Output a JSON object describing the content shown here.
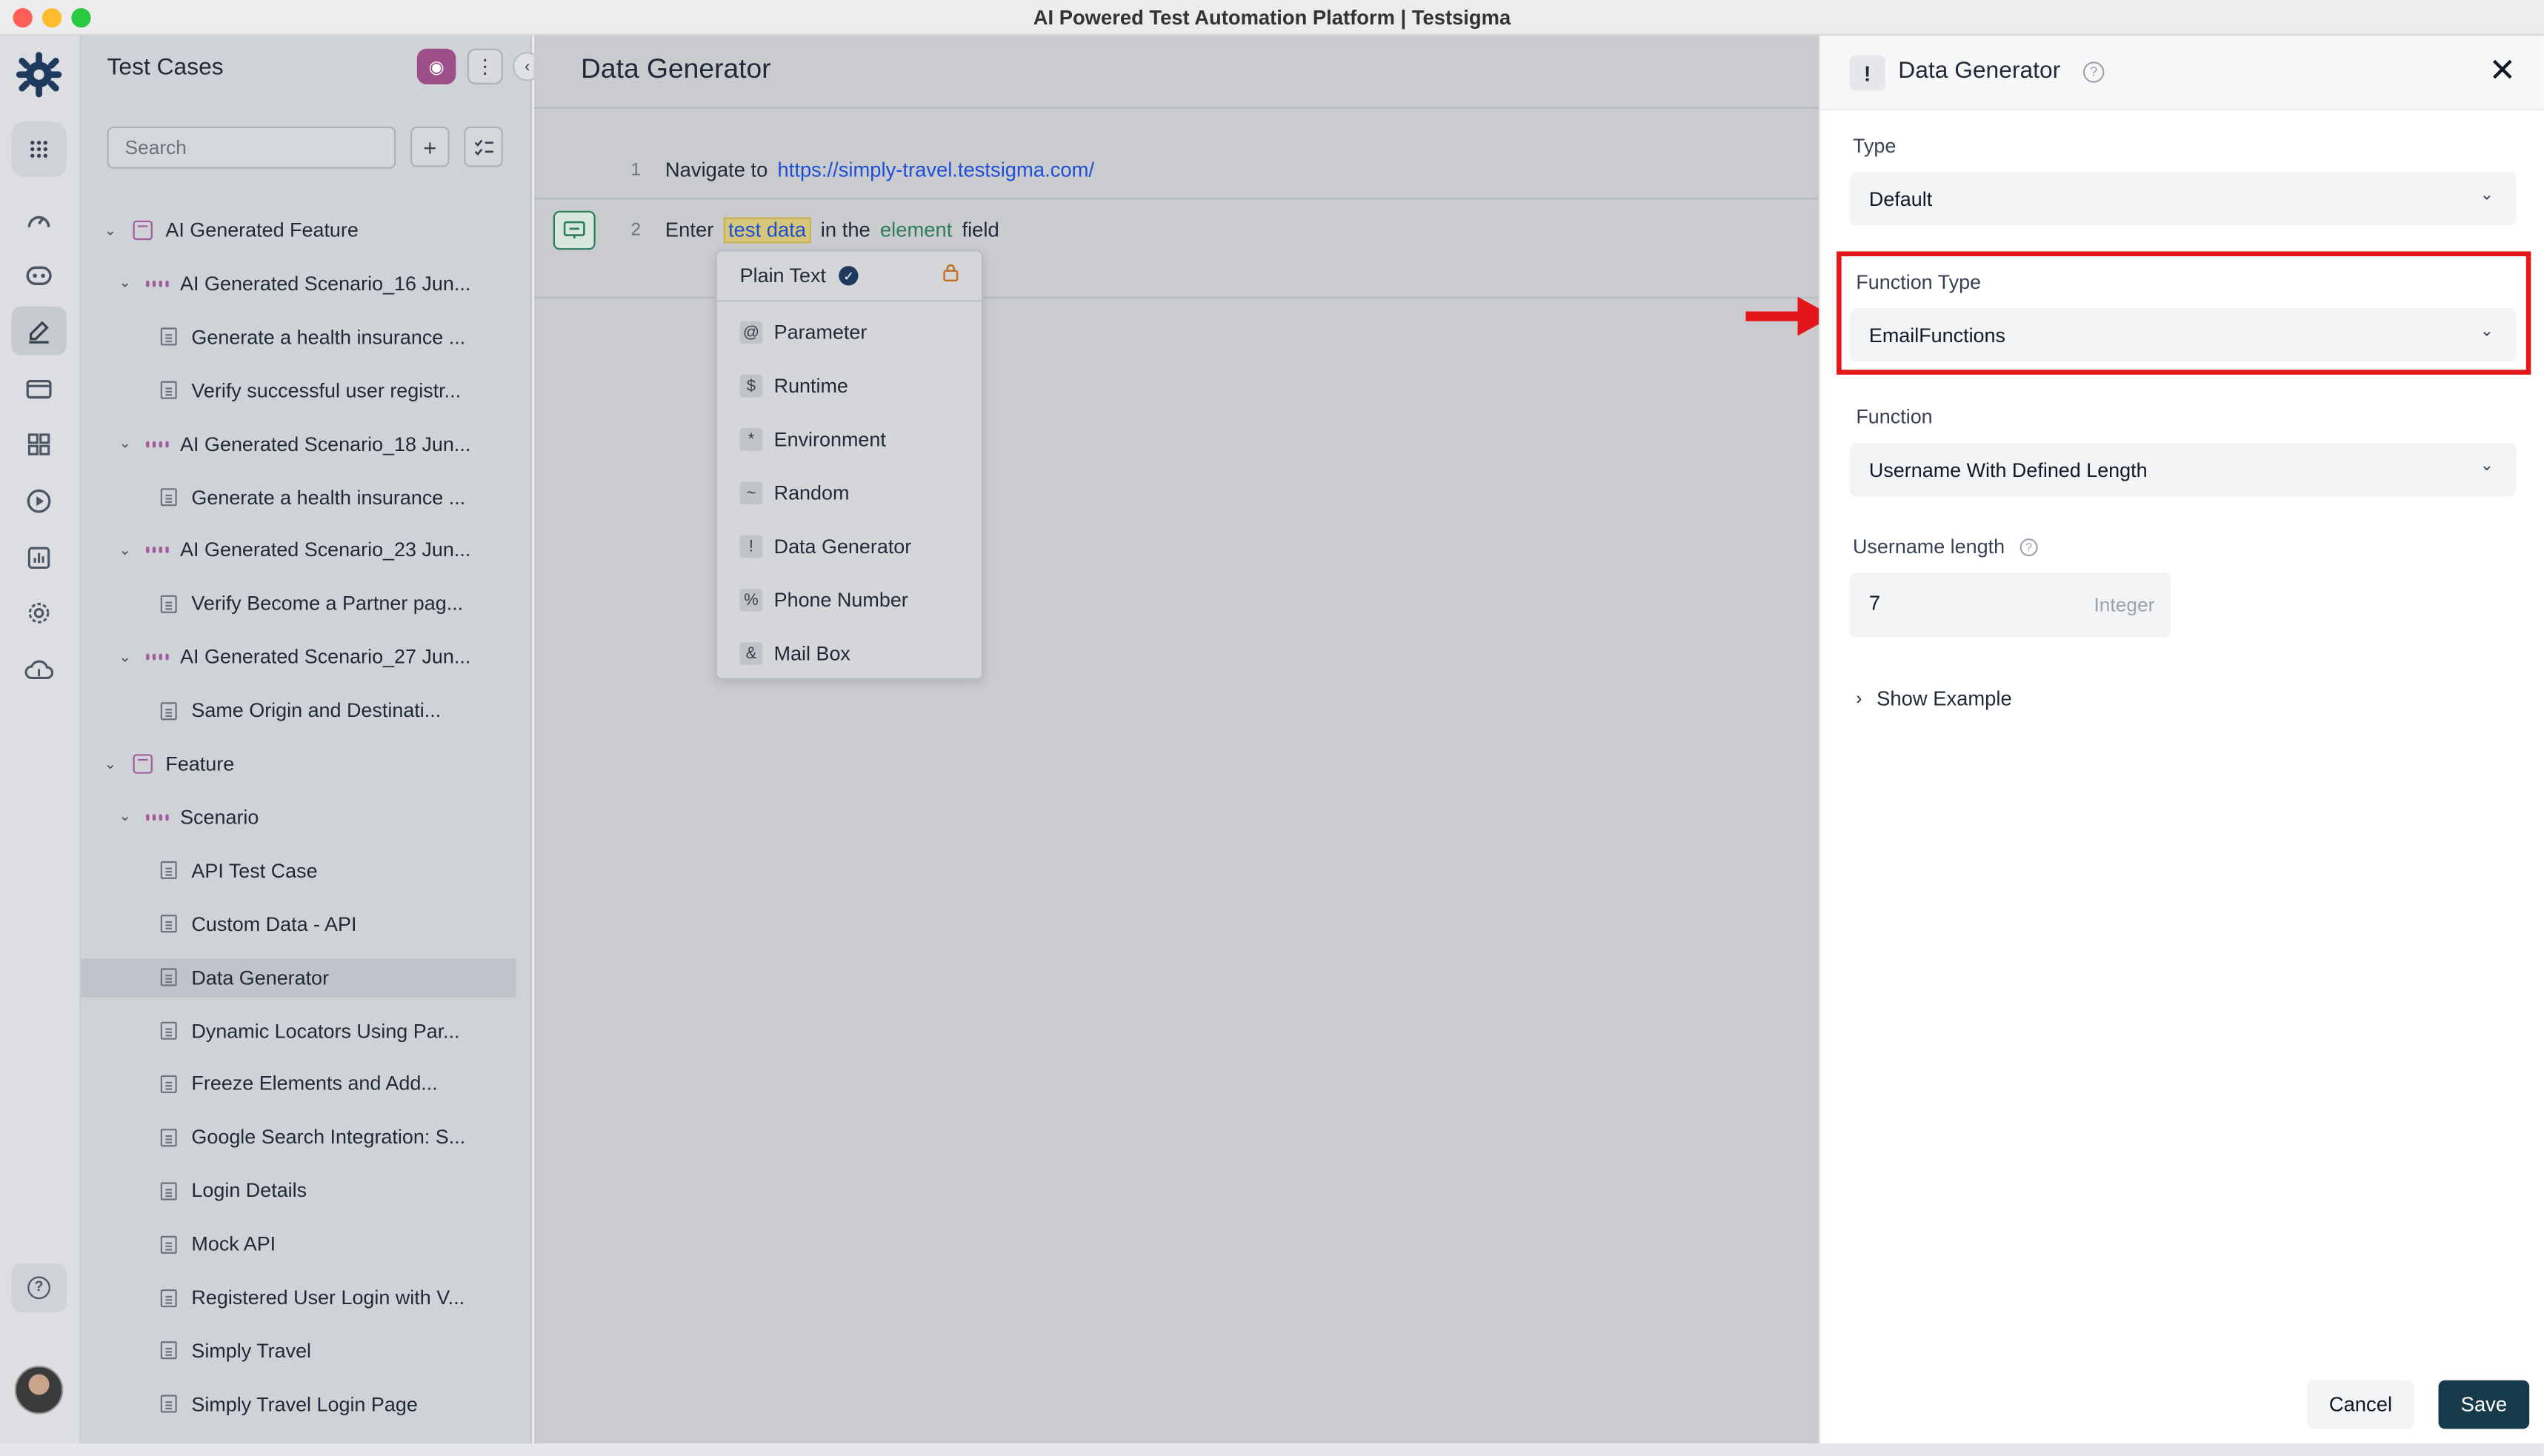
{
  "window": {
    "title": "AI Powered Test Automation Platform | Testsigma"
  },
  "sidebar": {
    "title": "Test Cases",
    "search_placeholder": "Search",
    "tree": [
      {
        "label": "AI Generated Feature",
        "kind": "feature"
      },
      {
        "label": "AI Generated Scenario_16 Jun...",
        "kind": "scenario"
      },
      {
        "label": "Generate a health insurance ...",
        "kind": "testcase"
      },
      {
        "label": "Verify successful user registr...",
        "kind": "testcase"
      },
      {
        "label": "AI Generated Scenario_18 Jun...",
        "kind": "scenario"
      },
      {
        "label": "Generate a health insurance ...",
        "kind": "testcase"
      },
      {
        "label": "AI Generated Scenario_23 Jun...",
        "kind": "scenario"
      },
      {
        "label": "Verify Become a Partner pag...",
        "kind": "testcase"
      },
      {
        "label": "AI Generated Scenario_27 Jun...",
        "kind": "scenario"
      },
      {
        "label": "Same Origin and Destinati...",
        "kind": "testcase"
      },
      {
        "label": "Feature",
        "kind": "feature"
      },
      {
        "label": "Scenario",
        "kind": "scenario"
      },
      {
        "label": "API Test Case",
        "kind": "testcase"
      },
      {
        "label": "Custom Data - API",
        "kind": "testcase"
      },
      {
        "label": "Data Generator",
        "kind": "testcase",
        "selected": true
      },
      {
        "label": "Dynamic Locators Using Par...",
        "kind": "testcase"
      },
      {
        "label": "Freeze Elements and Add...",
        "kind": "testcase"
      },
      {
        "label": "Google Search Integration: S...",
        "kind": "testcase"
      },
      {
        "label": "Login Details",
        "kind": "testcase"
      },
      {
        "label": "Mock API",
        "kind": "testcase"
      },
      {
        "label": "Registered User Login with V...",
        "kind": "testcase"
      },
      {
        "label": "Simply Travel",
        "kind": "testcase"
      },
      {
        "label": "Simply Travel Login Page",
        "kind": "testcase"
      }
    ]
  },
  "main": {
    "title": "Data Generator",
    "steps": [
      {
        "number": "1",
        "action": "Navigate to",
        "url": "https://simply-travel.testsigma.com/"
      },
      {
        "number": "2",
        "action": "Enter",
        "data_chip": "test data",
        "mid": "in the",
        "element": "element",
        "tail": "field"
      }
    ],
    "data_type_menu": {
      "selected": "Plain Text",
      "items": [
        {
          "key": "@",
          "label": "Parameter"
        },
        {
          "key": "$",
          "label": "Runtime"
        },
        {
          "key": "*",
          "label": "Environment"
        },
        {
          "key": "~",
          "label": "Random"
        },
        {
          "key": "!",
          "label": "Data Generator"
        },
        {
          "key": "%",
          "label": "Phone Number"
        },
        {
          "key": "&",
          "label": "Mail Box"
        }
      ]
    }
  },
  "drawer": {
    "icon_glyph": "!",
    "title": "Data Generator",
    "type_label": "Type",
    "type_value": "Default",
    "function_type_label": "Function Type",
    "function_type_value": "EmailFunctions",
    "function_label": "Function",
    "function_value": "Username With Defined Length",
    "param_label": "Username length",
    "param_value": "7",
    "param_type": "Integer",
    "show_example": "Show Example",
    "cancel": "Cancel",
    "save": "Save"
  },
  "colors": {
    "highlight_box": "#e4161a",
    "save_button": "#173a4a",
    "link": "#1d4ed8",
    "element_text": "#2d7d5c"
  }
}
